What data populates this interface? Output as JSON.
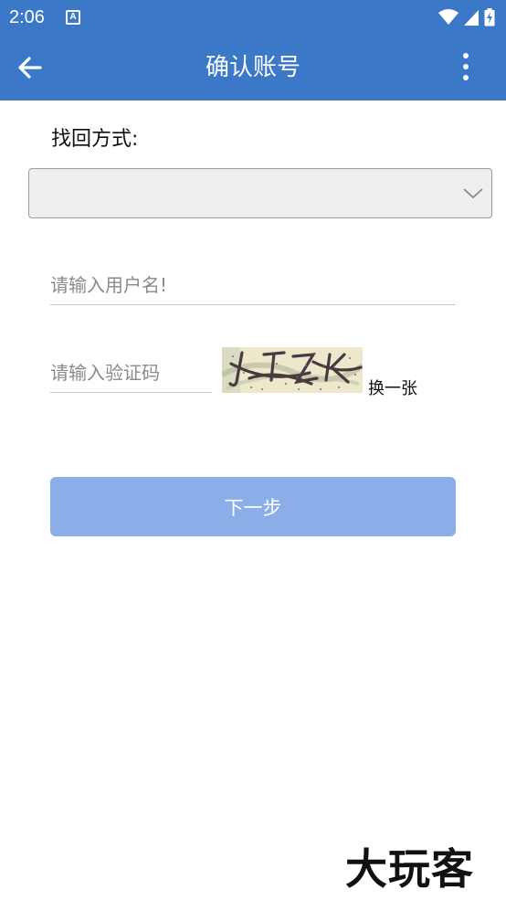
{
  "status_bar": {
    "time": "2:06",
    "app_icon_letter": "A",
    "icons": [
      "wifi-icon",
      "signal-icon",
      "battery-charging-icon"
    ]
  },
  "app_bar": {
    "title": "确认账号",
    "back_icon": "arrow-left-icon",
    "more_icon": "more-vertical-icon"
  },
  "form": {
    "method_label": "找回方式:",
    "method_select": {
      "value": "",
      "icon": "chevron-down-icon"
    },
    "username": {
      "value": "",
      "placeholder": "请输入用户名!"
    },
    "captcha": {
      "value": "",
      "placeholder": "请输入验证码",
      "image_text": "J T Z K",
      "refresh_label": "换一张"
    },
    "next_label": "下一步"
  },
  "colors": {
    "primary": "#3b78c8",
    "button": "#8caee8",
    "select_bg": "#eeeeee"
  },
  "watermark": "大玩客"
}
